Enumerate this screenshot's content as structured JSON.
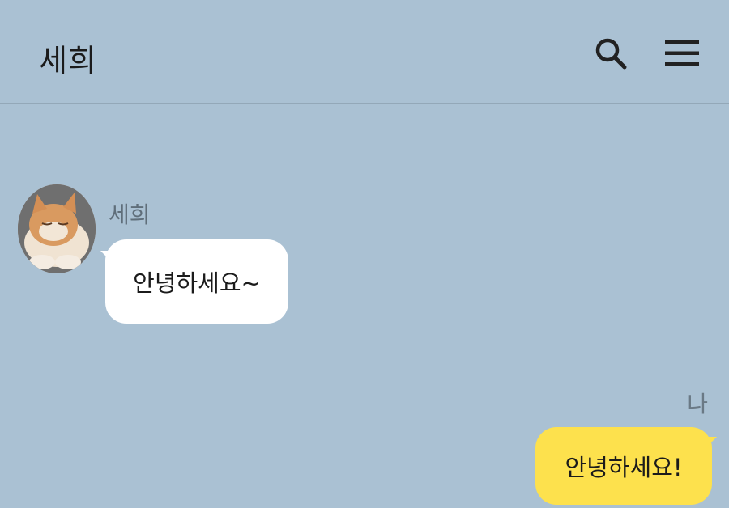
{
  "header": {
    "title": "세희",
    "search_icon": "search-icon",
    "menu_icon": "menu-icon"
  },
  "messages": [
    {
      "sender": "세희",
      "text": "안녕하세요~",
      "direction": "incoming",
      "avatar": "cat-photo"
    },
    {
      "sender": "나",
      "text": "안녕하세요!",
      "direction": "outgoing"
    }
  ],
  "colors": {
    "background": "#aac1d3",
    "incoming_bubble": "#ffffff",
    "outgoing_bubble": "#fde14d"
  }
}
